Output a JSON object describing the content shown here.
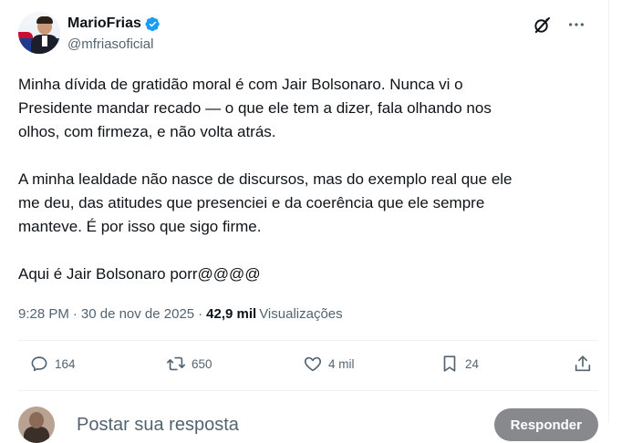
{
  "author": {
    "display_name": "MarioFrias",
    "handle": "@mfriasoficial",
    "verified": true
  },
  "tweet": {
    "text": "Minha dívida de gratidão moral é com Jair Bolsonaro. Nunca vi o\nPresidente mandar recado — o que ele tem a dizer, fala olhando nos\nolhos, com firmeza, e não volta atrás.\n\nA minha lealdade não nasce de discursos, mas do exemplo real que ele\nme deu, das atitudes que presenciei e da coerência que ele sempre\nmanteve. É por isso que sigo firme.\n\nAqui é Jair Bolsonaro porr@@@@"
  },
  "meta": {
    "time": "9:28 PM",
    "separator": "·",
    "date": "30 de nov de 2025",
    "views_count": "42,9 mil",
    "views_label": "Visualizações"
  },
  "actions": {
    "replies": "164",
    "reposts": "650",
    "likes": "4 mil",
    "bookmarks": "24"
  },
  "reply_box": {
    "placeholder": "Postar sua resposta",
    "button_label": "Responder"
  },
  "colors": {
    "text_primary": "#0f1419",
    "text_secondary": "#536471",
    "verified_blue": "#1d9bf0",
    "divider": "#eff3f4",
    "reply_button_bg": "#87898c"
  },
  "icons": {
    "verified": "verified-badge-icon",
    "grok": "grok-icon",
    "more": "more-icon",
    "reply": "reply-icon",
    "repost": "repost-icon",
    "like": "like-icon",
    "bookmark": "bookmark-icon",
    "share": "share-icon"
  }
}
